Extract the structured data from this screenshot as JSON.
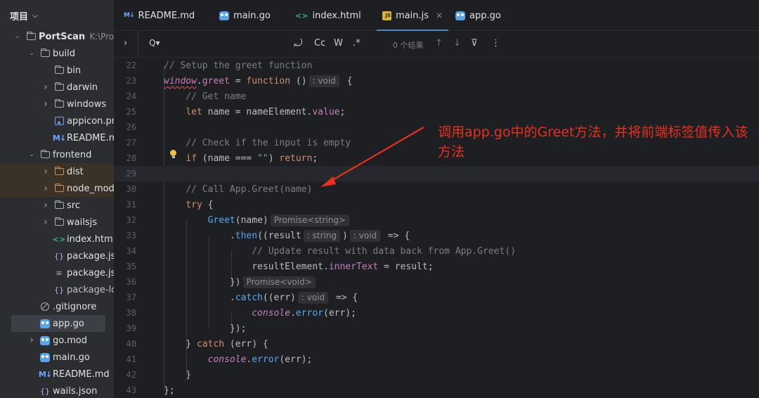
{
  "project": {
    "header": "项目",
    "tree": [
      {
        "label": "PortScan",
        "extra": "K:\\Progr",
        "kind": "folder",
        "level": 0,
        "arrow": "down",
        "bold": true
      },
      {
        "label": "build",
        "kind": "folder",
        "level": 1,
        "arrow": "down"
      },
      {
        "label": "bin",
        "kind": "folder",
        "level": 2,
        "arrow": ""
      },
      {
        "label": "darwin",
        "kind": "folder",
        "level": 2,
        "arrow": "right"
      },
      {
        "label": "windows",
        "kind": "folder",
        "level": 2,
        "arrow": "right"
      },
      {
        "label": "appicon.png",
        "kind": "png",
        "level": 2,
        "arrow": ""
      },
      {
        "label": "README.md",
        "kind": "md",
        "level": 2,
        "arrow": ""
      },
      {
        "label": "frontend",
        "kind": "folder",
        "level": 1,
        "arrow": "down"
      },
      {
        "label": "dist",
        "kind": "folder-orange",
        "level": 2,
        "arrow": "right",
        "excluded": true
      },
      {
        "label": "node_modules",
        "kind": "folder-orange",
        "level": 2,
        "arrow": "right",
        "excluded": true
      },
      {
        "label": "src",
        "kind": "folder",
        "level": 2,
        "arrow": "right"
      },
      {
        "label": "wailsjs",
        "kind": "folder",
        "level": 2,
        "arrow": "right"
      },
      {
        "label": "index.html",
        "kind": "html",
        "level": 2,
        "arrow": ""
      },
      {
        "label": "package.json",
        "kind": "json",
        "level": 2,
        "arrow": ""
      },
      {
        "label": "package.json",
        "kind": "lines",
        "level": 2,
        "arrow": ""
      },
      {
        "label": "package-lock.json",
        "kind": "json",
        "level": 2,
        "arrow": "",
        "dim": true
      },
      {
        "label": ".gitignore",
        "kind": "ignore",
        "level": 1,
        "arrow": ""
      },
      {
        "label": "app.go",
        "kind": "go",
        "level": 1,
        "arrow": "",
        "selected": true
      },
      {
        "label": "go.mod",
        "kind": "go",
        "level": 1,
        "arrow": "right"
      },
      {
        "label": "main.go",
        "kind": "go",
        "level": 1,
        "arrow": ""
      },
      {
        "label": "README.md",
        "kind": "md",
        "level": 1,
        "arrow": ""
      },
      {
        "label": "wails.json",
        "kind": "json",
        "level": 1,
        "arrow": ""
      }
    ]
  },
  "tabs": [
    {
      "label": "README.md",
      "icon": "md"
    },
    {
      "label": "main.go",
      "icon": "go"
    },
    {
      "label": "index.html",
      "icon": "html"
    },
    {
      "label": "main.js",
      "icon": "js",
      "active": true,
      "close": "×"
    },
    {
      "label": "app.go",
      "icon": "go"
    }
  ],
  "findbar": {
    "expand": "›",
    "search_icon": "Q▾",
    "replace_icon": "⤾",
    "match_case": "Cc",
    "words": "W",
    "regex": ".*",
    "results": "0 个结果",
    "prev": "↑",
    "next": "↓",
    "filter": "⊽",
    "more": "⋮"
  },
  "editor": {
    "lines": [
      {
        "n": "22",
        "tokens": [
          [
            "cm",
            "// Setup the greet function"
          ]
        ]
      },
      {
        "n": "23",
        "tokens": [
          [
            "wvar",
            "window"
          ],
          [
            "",
            "."
          ],
          [
            "prop",
            "greet"
          ],
          [
            "",
            " = "
          ],
          [
            "kw",
            "function"
          ],
          [
            "",
            " ()"
          ],
          [
            "hint",
            ": void"
          ],
          [
            "",
            " {"
          ]
        ]
      },
      {
        "n": "24",
        "tokens": [
          [
            "",
            "    "
          ],
          [
            "cm",
            "// Get name"
          ]
        ]
      },
      {
        "n": "25",
        "tokens": [
          [
            "",
            "    "
          ],
          [
            "kw",
            "let"
          ],
          [
            "",
            " name = nameElement."
          ],
          [
            "prop",
            "value"
          ],
          [
            "",
            ";"
          ]
        ]
      },
      {
        "n": "26",
        "tokens": []
      },
      {
        "n": "27",
        "tokens": [
          [
            "",
            "    "
          ],
          [
            "cm",
            "// Check if the input is empty"
          ]
        ]
      },
      {
        "n": "28",
        "tokens": [
          [
            "",
            "    "
          ],
          [
            "kw",
            "if"
          ],
          [
            "",
            " (name === "
          ],
          [
            "str",
            "\"\""
          ],
          [
            "",
            ") "
          ],
          [
            "kw",
            "return"
          ],
          [
            "",
            ";"
          ]
        ]
      },
      {
        "n": "29",
        "tokens": [],
        "caret": true
      },
      {
        "n": "30",
        "tokens": [
          [
            "",
            "    "
          ],
          [
            "cm",
            "// Call App.Greet(name)"
          ]
        ]
      },
      {
        "n": "31",
        "tokens": [
          [
            "",
            "    "
          ],
          [
            "kw",
            "try"
          ],
          [
            "",
            " {"
          ]
        ]
      },
      {
        "n": "32",
        "tokens": [
          [
            "",
            "        "
          ],
          [
            "fn",
            "Greet"
          ],
          [
            "",
            "(name)"
          ],
          [
            "hint",
            "Promise<string>"
          ]
        ]
      },
      {
        "n": "33",
        "tokens": [
          [
            "",
            "            ."
          ],
          [
            "fn",
            "then"
          ],
          [
            "",
            "((result"
          ],
          [
            "hint",
            ": string"
          ],
          [
            "",
            ")"
          ],
          [
            "hint",
            ": void"
          ],
          [
            "",
            " => {"
          ]
        ]
      },
      {
        "n": "34",
        "tokens": [
          [
            "",
            "                "
          ],
          [
            "cm",
            "// Update result with data back from App.Greet()"
          ]
        ]
      },
      {
        "n": "35",
        "tokens": [
          [
            "",
            "                resultElement."
          ],
          [
            "prop",
            "innerText"
          ],
          [
            "",
            " = result;"
          ]
        ]
      },
      {
        "n": "36",
        "tokens": [
          [
            "",
            "            })"
          ],
          [
            "hint",
            "Promise<void>"
          ]
        ]
      },
      {
        "n": "37",
        "tokens": [
          [
            "",
            "            ."
          ],
          [
            "fn",
            "catch"
          ],
          [
            "",
            "((err)"
          ],
          [
            "hint",
            ": void"
          ],
          [
            "",
            " => {"
          ]
        ]
      },
      {
        "n": "38",
        "tokens": [
          [
            "",
            "                "
          ],
          [
            "glb",
            "console"
          ],
          [
            "",
            "."
          ],
          [
            "fn",
            "error"
          ],
          [
            "",
            "(err);"
          ]
        ]
      },
      {
        "n": "39",
        "tokens": [
          [
            "",
            "            });"
          ]
        ]
      },
      {
        "n": "40",
        "tokens": [
          [
            "",
            "    } "
          ],
          [
            "kw",
            "catch"
          ],
          [
            "",
            " (err) {"
          ]
        ]
      },
      {
        "n": "41",
        "tokens": [
          [
            "",
            "        "
          ],
          [
            "glb",
            "console"
          ],
          [
            "",
            "."
          ],
          [
            "fn",
            "error"
          ],
          [
            "",
            "(err);"
          ]
        ]
      },
      {
        "n": "42",
        "tokens": [
          [
            "",
            "    }"
          ]
        ]
      },
      {
        "n": "43",
        "tokens": [
          [
            "",
            "};"
          ]
        ]
      }
    ]
  },
  "annotation": {
    "text": "调用app.go中的Greet方法，并将前端标签值传入该方法",
    "color": "#e8301f"
  }
}
